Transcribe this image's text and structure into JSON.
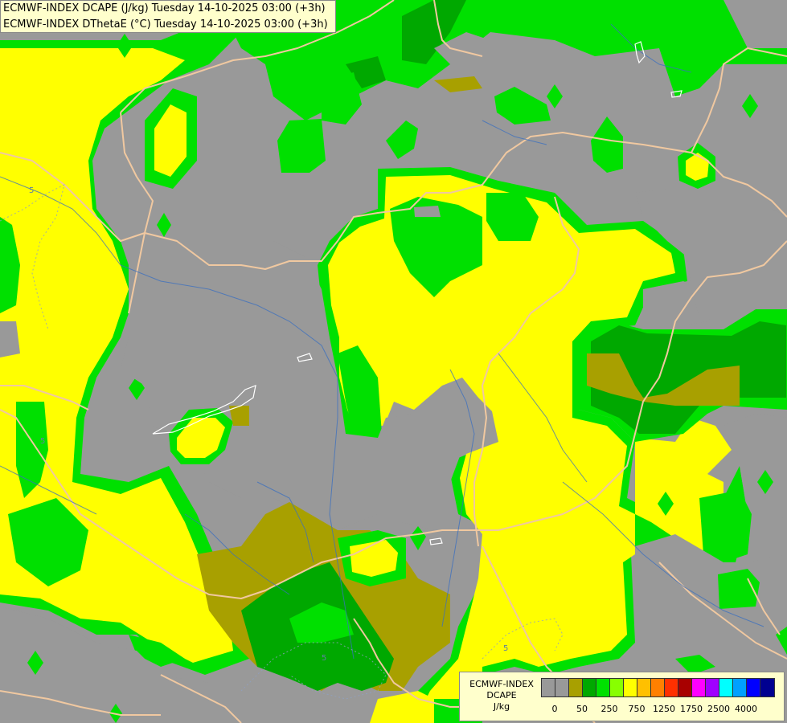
{
  "header": {
    "line1": "ECMWF-INDEX DCAPE (J/kg) Tuesday 14-10-2025 03:00 (+3h)",
    "line2": "ECMWF-INDEX DThetaE (°C) Tuesday 14-10-2025 03:00 (+3h)"
  },
  "legend": {
    "line1": "ECMWF-INDEX",
    "line2": "DCAPE",
    "line3": "J/kg",
    "colors": [
      "#999999",
      "#999999",
      "#a8a000",
      "#00a800",
      "#00e000",
      "#88ff00",
      "#ffff00",
      "#ffc000",
      "#ff8000",
      "#ff3000",
      "#a80000",
      "#ff00ff",
      "#a000ff",
      "#00ffff",
      "#00a0ff",
      "#0000ff",
      "#000090"
    ],
    "ticks": [
      "0",
      "50",
      "250",
      "750",
      "1250",
      "1750",
      "2500",
      "4000"
    ]
  },
  "map": {
    "contour_labels": [
      "5",
      "5",
      "5",
      "5"
    ],
    "colors": {
      "low": "#999999",
      "olive": "#a8a000",
      "dark_green": "#00a800",
      "green": "#00e000",
      "light_green": "#7dff00",
      "yellow": "#ffff00",
      "borders": "#f0c8a0",
      "rivers": "#3a6fc0",
      "lakes": "#ffffff"
    }
  }
}
